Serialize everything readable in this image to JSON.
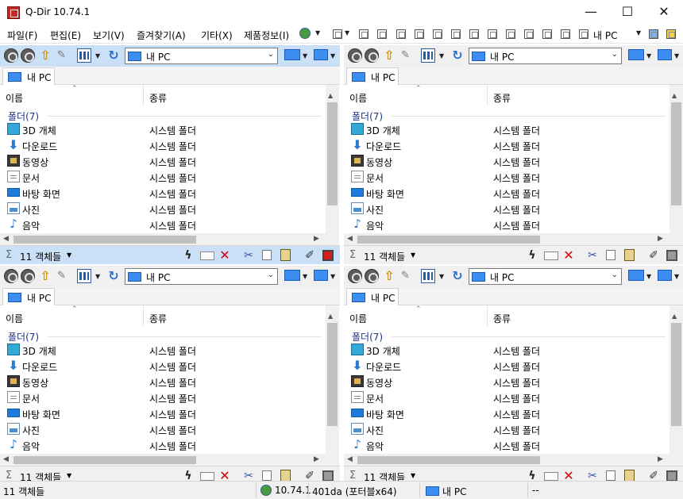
{
  "window": {
    "title": "Q-Dir 10.74.1",
    "minimize": "—",
    "maximize": "☐",
    "close": "✕"
  },
  "menu": {
    "items": [
      "파일(F)",
      "편집(E)",
      "보기(V)",
      "즐겨찾기(A)",
      "기타(X)",
      "제품정보(I)"
    ],
    "right_label": "내 PC",
    "drop": "▼"
  },
  "pane": {
    "address": "내 PC",
    "tab_label": "내 PC",
    "columns": {
      "name": "이름",
      "type": "종류"
    },
    "group_label": "폴더(7)",
    "items": [
      {
        "name": "3D 개체",
        "type": "시스템 폴더",
        "icon": "3d-objects-icon"
      },
      {
        "name": "다운로드",
        "type": "시스템 폴더",
        "icon": "downloads-icon"
      },
      {
        "name": "동영상",
        "type": "시스템 폴더",
        "icon": "videos-icon"
      },
      {
        "name": "문서",
        "type": "시스템 폴더",
        "icon": "documents-icon"
      },
      {
        "name": "바탕 화면",
        "type": "시스템 폴더",
        "icon": "desktop-icon"
      },
      {
        "name": "사진",
        "type": "시스템 폴더",
        "icon": "pictures-icon"
      },
      {
        "name": "음악",
        "type": "시스템 폴더",
        "icon": "music-icon"
      }
    ],
    "status_count": "11 객체들",
    "sigma": "Σ",
    "caret": "▼",
    "sort": "⌃"
  },
  "status": {
    "left": "11 객체들",
    "version": "10.74.1",
    "build": "401da (포터블x64)",
    "location": "내 PC",
    "extra": "--"
  },
  "colors": {
    "active_toolbar": "#c9e0f7",
    "accent": "#3c8ef0",
    "group_text": "#1e3287"
  }
}
